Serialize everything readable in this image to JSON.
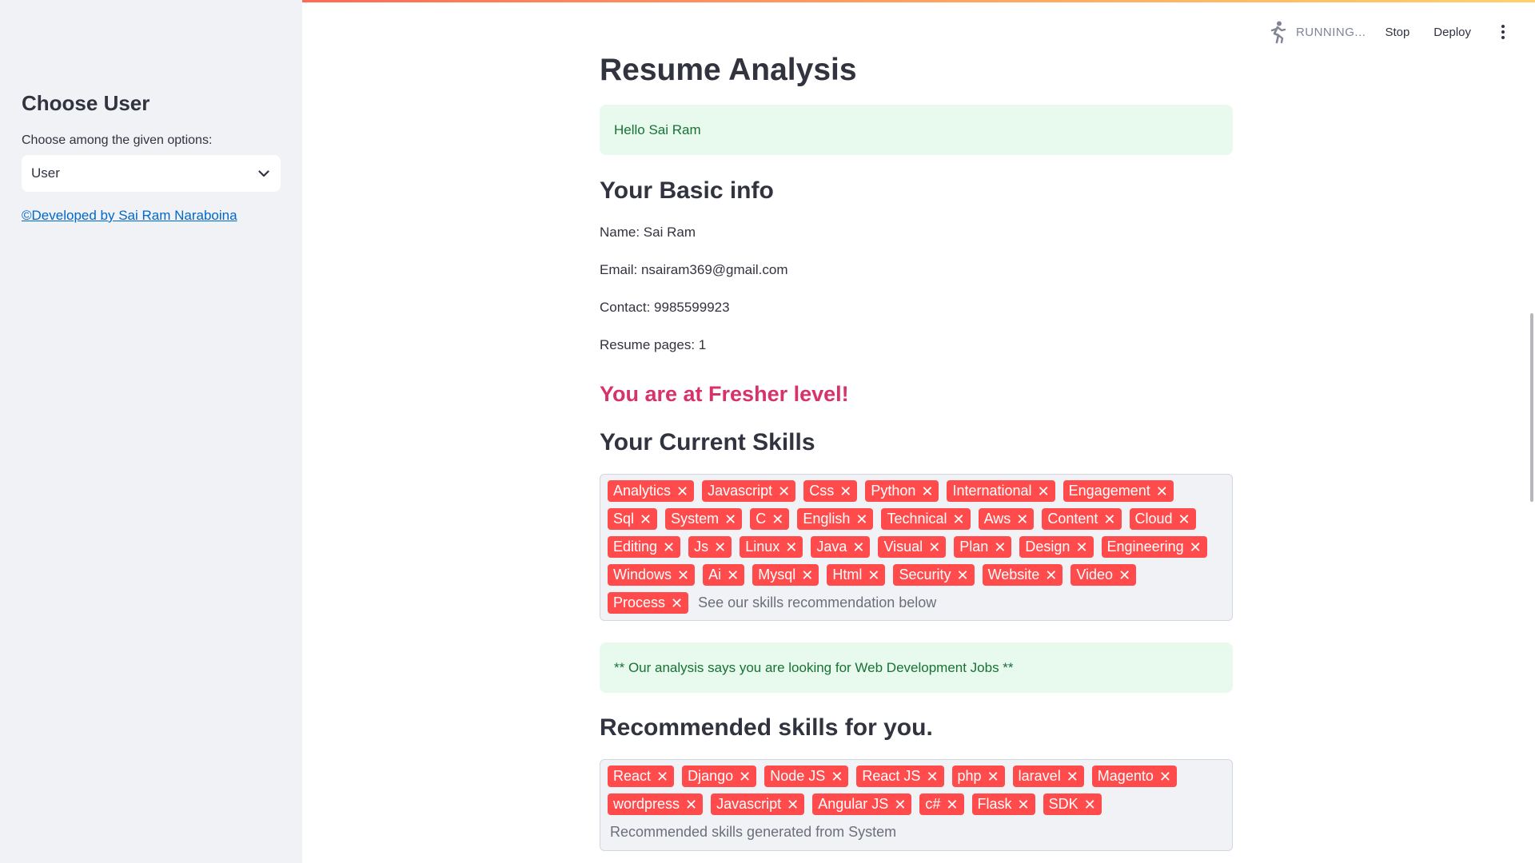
{
  "app": {
    "status": "RUNNING...",
    "stop_label": "Stop",
    "deploy_label": "Deploy",
    "menu_icon": "kebab-menu-icon",
    "running_icon": "running-person-icon",
    "accent_color": "#ff4b4b"
  },
  "sidebar": {
    "title": "Choose User",
    "select_label": "Choose among the given options:",
    "select_value": "User",
    "footer_link": "©Developed by Sai Ram Naraboina"
  },
  "main": {
    "title": "Resume Analysis",
    "greeting": "Hello Sai Ram",
    "basic_info_heading": "Your Basic info",
    "name": "Name: Sai Ram",
    "email": "Email: nsairam369@gmail.com",
    "contact": "Contact: 9985599923",
    "pages": "Resume pages: 1",
    "level": "You are at Fresher level!",
    "skills_heading": "Your Current Skills",
    "skills": [
      "Analytics",
      "Javascript",
      "Css",
      "Python",
      "International",
      "Engagement",
      "Sql",
      "System",
      "C",
      "English",
      "Technical",
      "Aws",
      "Content",
      "Cloud",
      "Editing",
      "Js",
      "Linux",
      "Java",
      "Visual",
      "Plan",
      "Design",
      "Engineering",
      "Windows",
      "Ai",
      "Mysql",
      "Html",
      "Security",
      "Website",
      "Video",
      "Process"
    ],
    "skills_placeholder": "See our skills recommendation below",
    "analysis_message": "** Our analysis says you are looking for Web Development Jobs **",
    "recommended_heading": "Recommended skills for you.",
    "recommended_skills": [
      "React",
      "Django",
      "Node JS",
      "React JS",
      "php",
      "laravel",
      "Magento",
      "wordpress",
      "Javascript",
      "Angular JS",
      "c#",
      "Flask",
      "SDK"
    ],
    "recommended_placeholder": "Recommended skills generated from System"
  }
}
